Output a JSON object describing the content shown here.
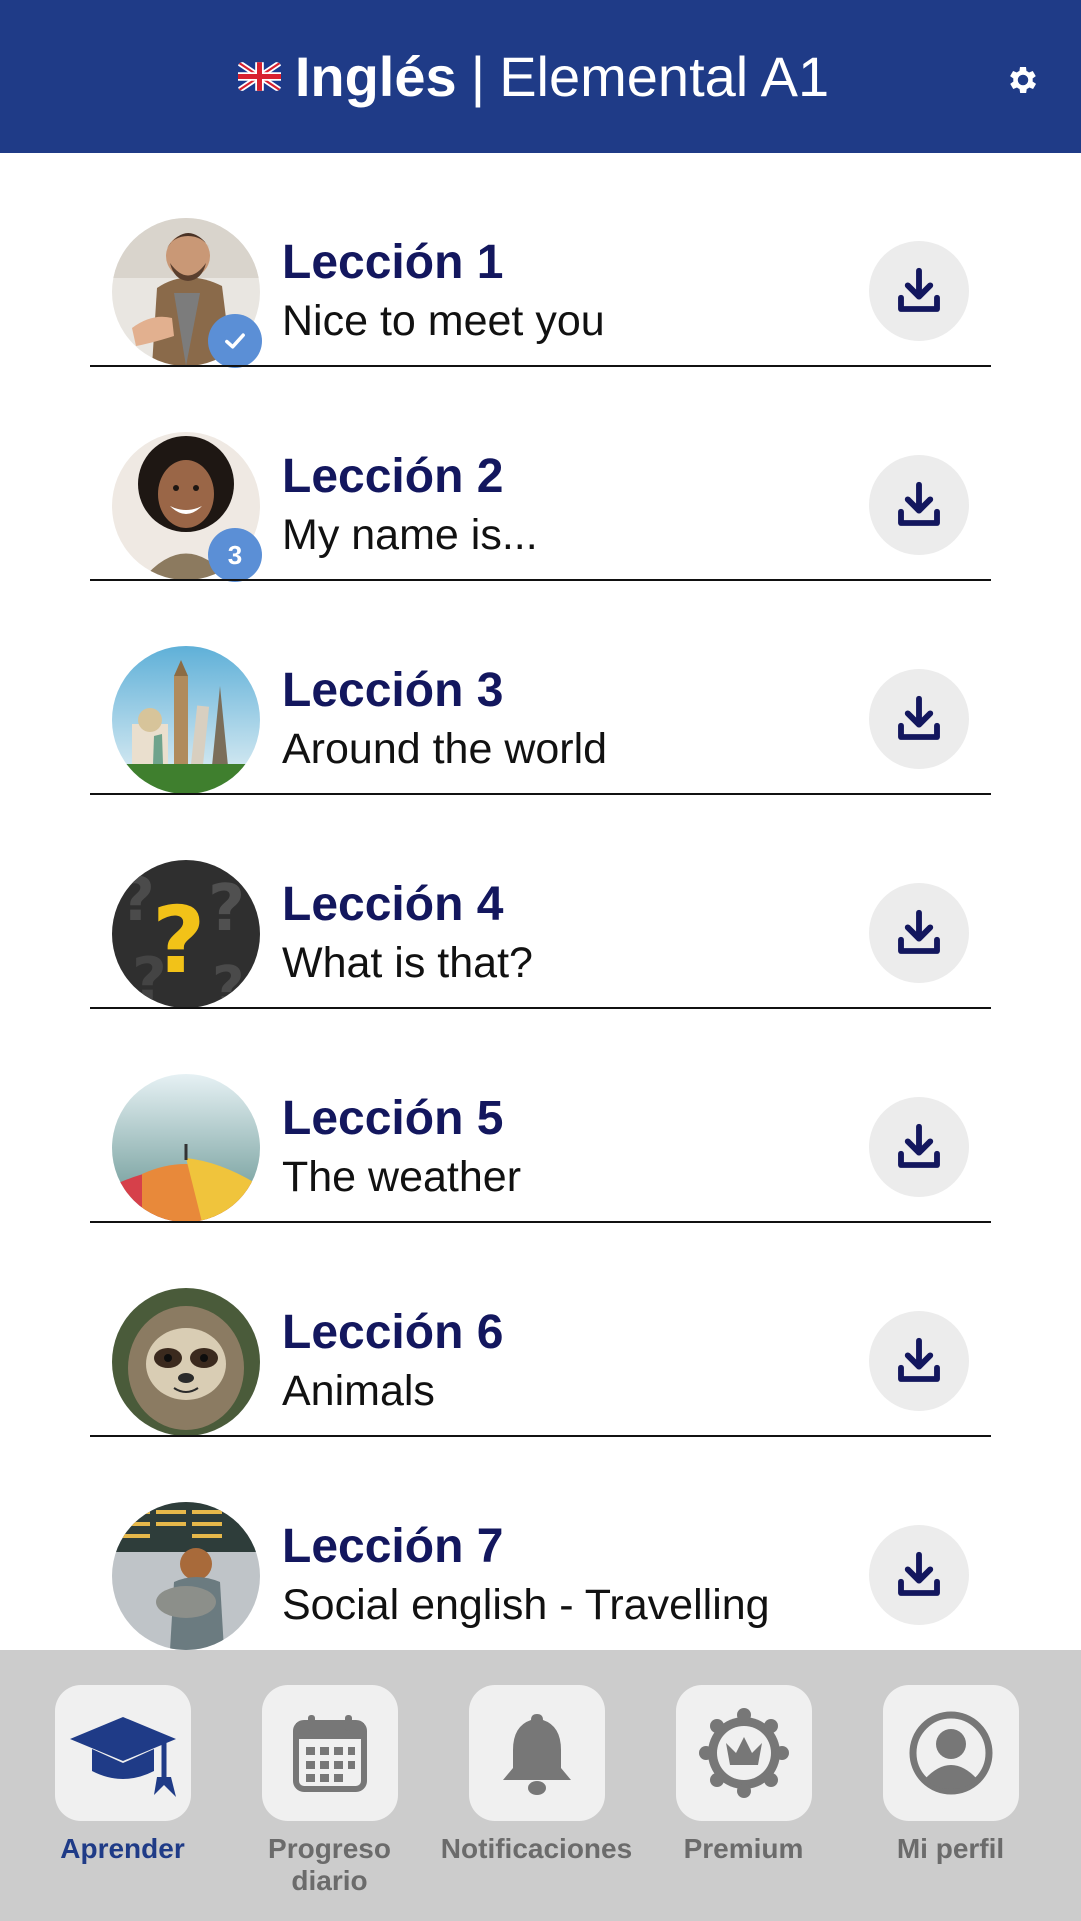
{
  "header": {
    "language": "Inglés",
    "separator": "|",
    "level": "Elemental A1",
    "flag_icon": "uk-flag-icon",
    "settings_icon": "gear-icon"
  },
  "lessons": [
    {
      "number": "Lección 1",
      "title": "Nice to meet you",
      "badge": "✓",
      "badge_kind": "completed"
    },
    {
      "number": "Lección 2",
      "title": "My name is...",
      "badge": "3",
      "badge_kind": "count"
    },
    {
      "number": "Lección 3",
      "title": "Around the world",
      "badge": ""
    },
    {
      "number": "Lección 4",
      "title": "What is that?",
      "badge": ""
    },
    {
      "number": "Lección 5",
      "title": "The weather",
      "badge": ""
    },
    {
      "number": "Lección 6",
      "title": "Animals",
      "badge": ""
    },
    {
      "number": "Lección 7",
      "title": "Social english - Travelling",
      "badge": ""
    }
  ],
  "download_icon": "download-icon",
  "tabbar": {
    "tabs": [
      {
        "label": "Aprender",
        "icon": "graduation-cap-icon",
        "active": true
      },
      {
        "label": "Progreso diario",
        "icon": "calendar-icon",
        "active": false
      },
      {
        "label": "Notificaciones",
        "icon": "bell-icon",
        "active": false
      },
      {
        "label": "Premium",
        "icon": "crown-badge-icon",
        "active": false
      },
      {
        "label": "Mi perfil",
        "icon": "user-profile-icon",
        "active": false
      }
    ]
  },
  "colors": {
    "header_bg": "#1f3b87",
    "lesson_number": "#13175e",
    "badge": "#5b8fd6",
    "tabbar_bg": "#cccccc",
    "active_tab": "#1f3b87"
  }
}
